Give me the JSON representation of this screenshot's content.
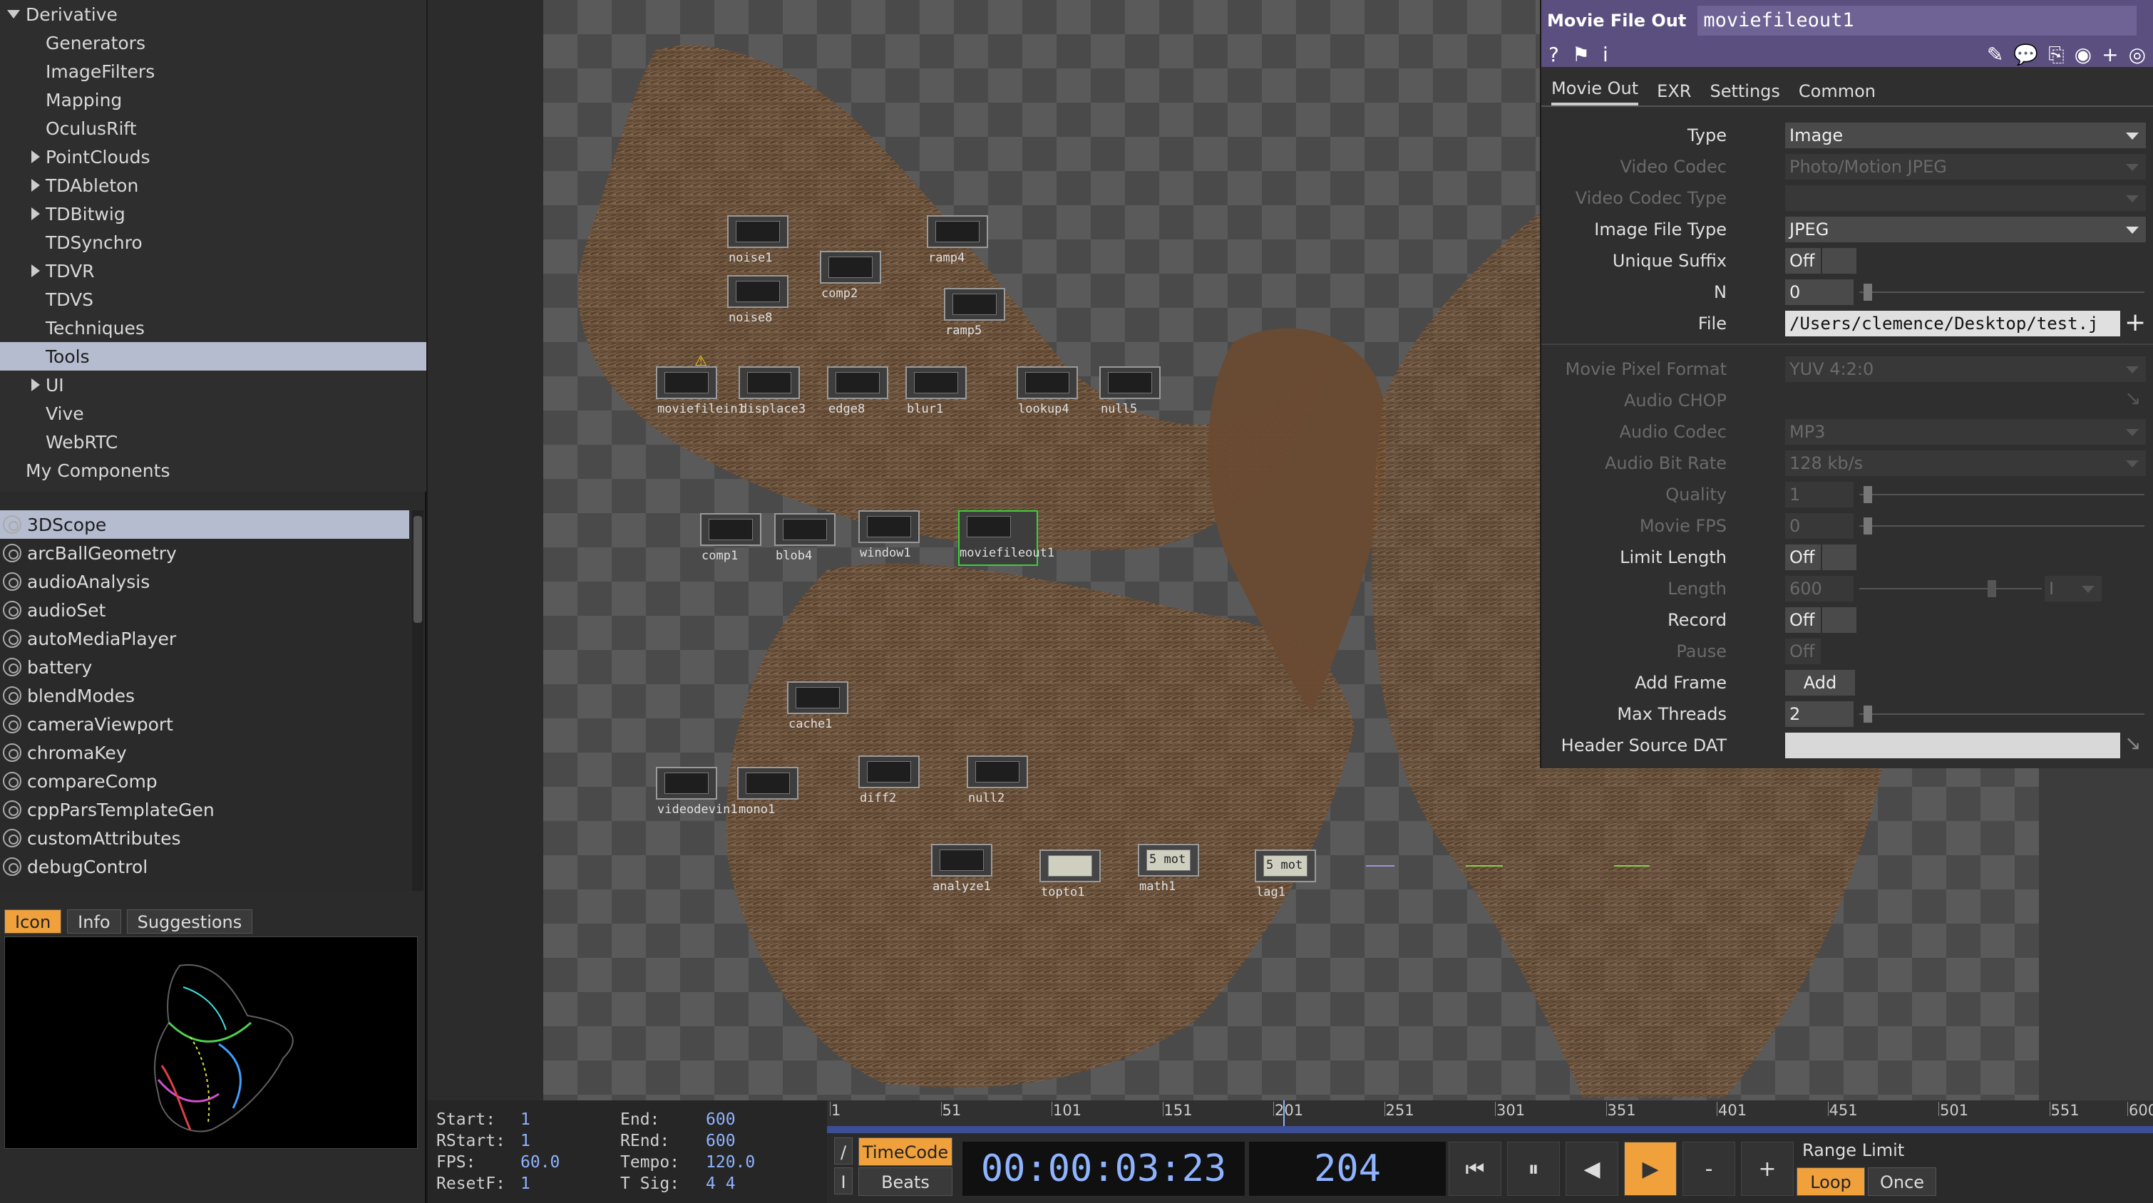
{
  "palette": {
    "tree_items": [
      {
        "label": "Derivative",
        "expand": "down",
        "indent": 0
      },
      {
        "label": "Generators",
        "expand": "",
        "indent": 2
      },
      {
        "label": "ImageFilters",
        "expand": "",
        "indent": 2
      },
      {
        "label": "Mapping",
        "expand": "",
        "indent": 2
      },
      {
        "label": "OculusRift",
        "expand": "",
        "indent": 2
      },
      {
        "label": "PointClouds",
        "expand": "right",
        "indent": 2
      },
      {
        "label": "TDAbleton",
        "expand": "right",
        "indent": 2
      },
      {
        "label": "TDBitwig",
        "expand": "right",
        "indent": 2
      },
      {
        "label": "TDSynchro",
        "expand": "",
        "indent": 2
      },
      {
        "label": "TDVR",
        "expand": "right",
        "indent": 2
      },
      {
        "label": "TDVS",
        "expand": "",
        "indent": 2
      },
      {
        "label": "Techniques",
        "expand": "",
        "indent": 2
      },
      {
        "label": "Tools",
        "expand": "",
        "indent": 2,
        "selected": true
      },
      {
        "label": "UI",
        "expand": "right",
        "indent": 2
      },
      {
        "label": "Vive",
        "expand": "",
        "indent": 2
      },
      {
        "label": "WebRTC",
        "expand": "",
        "indent": 2
      },
      {
        "label": "My Components",
        "expand": "",
        "indent": 1
      }
    ],
    "components": [
      "3DScope",
      "arcBallGeometry",
      "audioAnalysis",
      "audioSet",
      "autoMediaPlayer",
      "battery",
      "blendModes",
      "cameraViewport",
      "chromaKey",
      "compareComp",
      "cppParsTemplateGen",
      "customAttributes",
      "debugControl"
    ],
    "selected_component": "3DScope",
    "bottom_tabs": [
      "Icon",
      "Info",
      "Suggestions"
    ],
    "active_tab": "Icon"
  },
  "network": {
    "nodes": [
      {
        "name": "noise1",
        "kind": "top"
      },
      {
        "name": "noise8",
        "kind": "top"
      },
      {
        "name": "comp2",
        "kind": "top"
      },
      {
        "name": "ramp4",
        "kind": "top"
      },
      {
        "name": "ramp5",
        "kind": "top"
      },
      {
        "name": "moviefilein1",
        "kind": "top",
        "warning": true
      },
      {
        "name": "displace3",
        "kind": "top"
      },
      {
        "name": "edge8",
        "kind": "top"
      },
      {
        "name": "blur1",
        "kind": "top"
      },
      {
        "name": "lookup4",
        "kind": "top"
      },
      {
        "name": "null5",
        "kind": "top"
      },
      {
        "name": "comp1",
        "kind": "top"
      },
      {
        "name": "blob4",
        "kind": "top"
      },
      {
        "name": "window1",
        "kind": "top"
      },
      {
        "name": "moviefileout1",
        "kind": "top",
        "selected": true
      },
      {
        "name": "cache1",
        "kind": "top"
      },
      {
        "name": "videodevin1",
        "kind": "top"
      },
      {
        "name": "mono1",
        "kind": "top"
      },
      {
        "name": "diff2",
        "kind": "top"
      },
      {
        "name": "null2",
        "kind": "top"
      },
      {
        "name": "analyze1",
        "kind": "top"
      },
      {
        "name": "topto1",
        "kind": "chop"
      },
      {
        "name": "math1",
        "kind": "chop",
        "value": "5 mot"
      },
      {
        "name": "lag1",
        "kind": "chop",
        "value": "5 mot"
      }
    ]
  },
  "params": {
    "op_type": "Movie File Out",
    "op_name": "moviefileout1",
    "header_icons": [
      "help-icon",
      "python-help-icon",
      "info-icon"
    ],
    "tool_icons": [
      "edit-icon",
      "comment-icon",
      "clone-icon",
      "python-icon",
      "add-icon",
      "target-icon"
    ],
    "tabs": [
      "Movie Out",
      "EXR",
      "Settings",
      "Common"
    ],
    "active_tab": "Movie Out",
    "rows": [
      {
        "label": "Type",
        "value": "Image",
        "kind": "drop",
        "dim": false
      },
      {
        "label": "Video Codec",
        "value": "Photo/Motion JPEG",
        "kind": "drop",
        "dim": true
      },
      {
        "label": "Video Codec Type",
        "value": "",
        "kind": "drop",
        "dim": true
      },
      {
        "label": "Image File Type",
        "value": "JPEG",
        "kind": "drop",
        "dim": false
      },
      {
        "label": "Unique Suffix",
        "value": "Off",
        "kind": "toggle",
        "dim": false
      },
      {
        "label": "N",
        "value": "0",
        "kind": "slider",
        "dim": false
      },
      {
        "label": "File",
        "value": "/Users/clemence/Desktop/test.j",
        "kind": "file",
        "dim": false
      },
      {
        "label": "Movie Pixel Format",
        "value": "YUV 4:2:0",
        "kind": "drop",
        "dim": true
      },
      {
        "label": "Audio CHOP",
        "value": "",
        "kind": "chop",
        "dim": true
      },
      {
        "label": "Audio Codec",
        "value": "MP3",
        "kind": "drop",
        "dim": true
      },
      {
        "label": "Audio Bit Rate",
        "value": "128 kb/s",
        "kind": "drop",
        "dim": true
      },
      {
        "label": "Quality",
        "value": "1",
        "kind": "slider",
        "dim": true
      },
      {
        "label": "Movie FPS",
        "value": "0",
        "kind": "slider",
        "dim": true
      },
      {
        "label": "Limit Length",
        "value": "Off",
        "kind": "toggle",
        "dim": false
      },
      {
        "label": "Length",
        "value": "600",
        "kind": "length",
        "dim": true,
        "unit": "I"
      },
      {
        "label": "Record",
        "value": "Off",
        "kind": "toggle",
        "dim": false
      },
      {
        "label": "Pause",
        "value": "Off",
        "kind": "toggle",
        "dim": true
      },
      {
        "label": "Add Frame",
        "value": "Add",
        "kind": "button",
        "dim": false
      },
      {
        "label": "Max Threads",
        "value": "2",
        "kind": "slider",
        "dim": false
      },
      {
        "label": "Header Source DAT",
        "value": "",
        "kind": "dat",
        "dim": false
      }
    ]
  },
  "timeline": {
    "info": [
      {
        "label": "Start:",
        "value": "1"
      },
      {
        "label": "RStart:",
        "value": "1"
      },
      {
        "label": "FPS:",
        "value": "60.0"
      },
      {
        "label": "ResetF:",
        "value": "1"
      },
      {
        "label": "End:",
        "value": "600"
      },
      {
        "label": "REnd:",
        "value": "600"
      },
      {
        "label": "Tempo:",
        "value": "120.0"
      },
      {
        "label": "T Sig:",
        "value": "4    4"
      }
    ],
    "ruler_ticks": [
      "1",
      "51",
      "101",
      "151",
      "201",
      "251",
      "301",
      "351",
      "401",
      "451",
      "501",
      "551",
      "600"
    ],
    "timecode_label": "TimeCode",
    "beats_label": "Beats",
    "timecode": "00:00:03:23",
    "frame": "204",
    "range_limit_label": "Range Limit",
    "loop_label": "Loop",
    "once_label": "Once",
    "slash_label": "/",
    "bar_label": "I",
    "transport": [
      "⏮",
      "⏸",
      "◀",
      "▶",
      "-",
      "+"
    ]
  },
  "colors": {
    "accent": "#f0a13c",
    "op_header": "#5b4f7f",
    "timecode_text": "#8fb3ff",
    "selection": "#b6bccf"
  }
}
